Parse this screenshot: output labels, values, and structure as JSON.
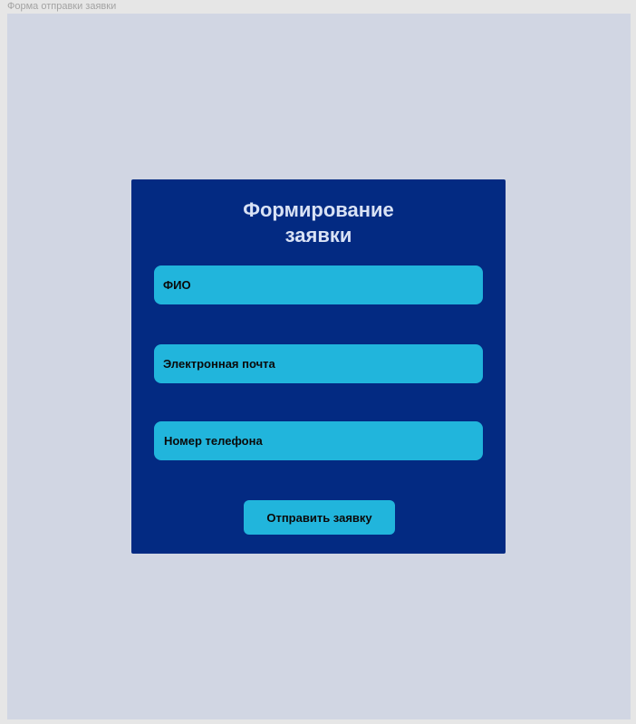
{
  "frame": {
    "label": "Форма отправки заявки"
  },
  "form": {
    "title": "Формирование\nзаявки",
    "fields": [
      {
        "label": "ФИО"
      },
      {
        "label": "Электронная почта"
      },
      {
        "label": "Номер телефона"
      }
    ],
    "submit_label": "Отправить заявку"
  },
  "colors": {
    "background": "#d1d6e3",
    "card": "#032a82",
    "field": "#21b5dc",
    "title": "#d9e2f5"
  }
}
